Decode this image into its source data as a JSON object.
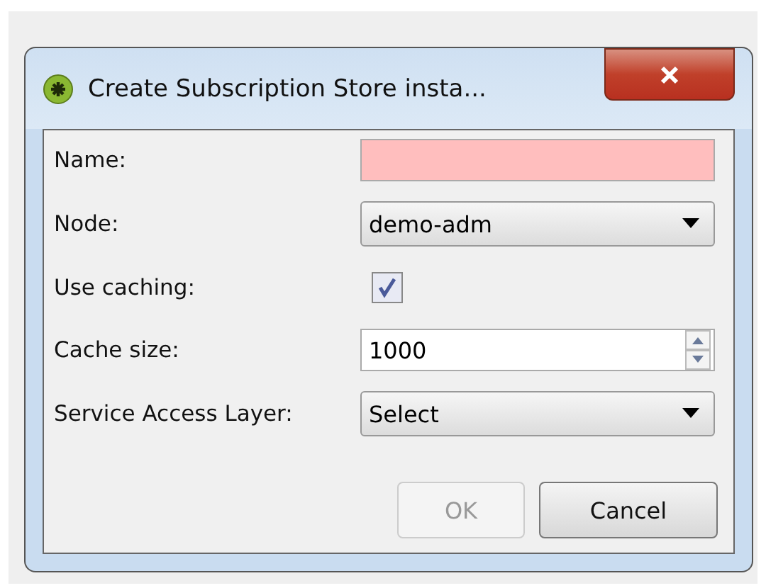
{
  "window": {
    "title": "Create Subscription Store insta..."
  },
  "fields": [
    {
      "kind": "text",
      "label": "Name:",
      "invalid": true
    },
    {
      "kind": "dropdown",
      "label": "Node:",
      "value": "demo-adm"
    },
    {
      "kind": "checkbox",
      "label": "Use caching:",
      "checked": true
    },
    {
      "kind": "spinner",
      "label": "Cache size:",
      "value": "1000"
    },
    {
      "kind": "dropdown",
      "label": "Service Access Layer:",
      "value": "Select"
    }
  ],
  "buttons": [
    {
      "label": "OK",
      "disabled": true
    },
    {
      "label": "Cancel",
      "disabled": false
    }
  ]
}
